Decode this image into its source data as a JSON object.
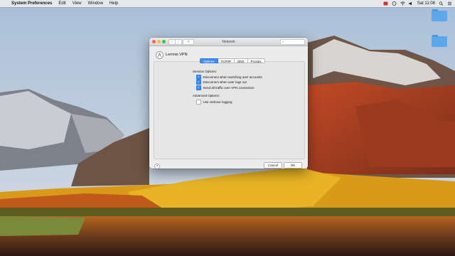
{
  "menubar": {
    "apple": "",
    "app_name": "System Preferences",
    "items": [
      "Edit",
      "View",
      "Window",
      "Help"
    ],
    "clock": "Sat 11:08"
  },
  "desktop": {
    "folders": [
      {
        "label": "."
      },
      {
        "label": ""
      }
    ]
  },
  "window": {
    "title": "Network",
    "back_label": "‹",
    "forward_label": "›",
    "grid_label": "⠿",
    "search_placeholder": "",
    "service_name": "Lemnis VPN",
    "tabs": [
      {
        "label": "Options",
        "active": true
      },
      {
        "label": "TCP/IP",
        "active": false
      },
      {
        "label": "DNS",
        "active": false
      },
      {
        "label": "Proxies",
        "active": false
      }
    ],
    "session_heading": "Session Options:",
    "session_options": [
      {
        "label": "Disconnect when switching user accounts",
        "checked": true
      },
      {
        "label": "Disconnect when user logs out",
        "checked": true
      },
      {
        "label": "Send all traffic over VPN connection",
        "checked": true
      }
    ],
    "advanced_heading": "Advanced Options:",
    "advanced_options": [
      {
        "label": "Use verbose logging",
        "checked": false
      }
    ],
    "help_label": "?",
    "cancel_label": "Cancel",
    "ok_label": "OK"
  },
  "colors": {
    "accent": "#3e8cf2",
    "close": "#fc605c",
    "minimize": "#fdbc40",
    "zoom": "#34c84a"
  }
}
